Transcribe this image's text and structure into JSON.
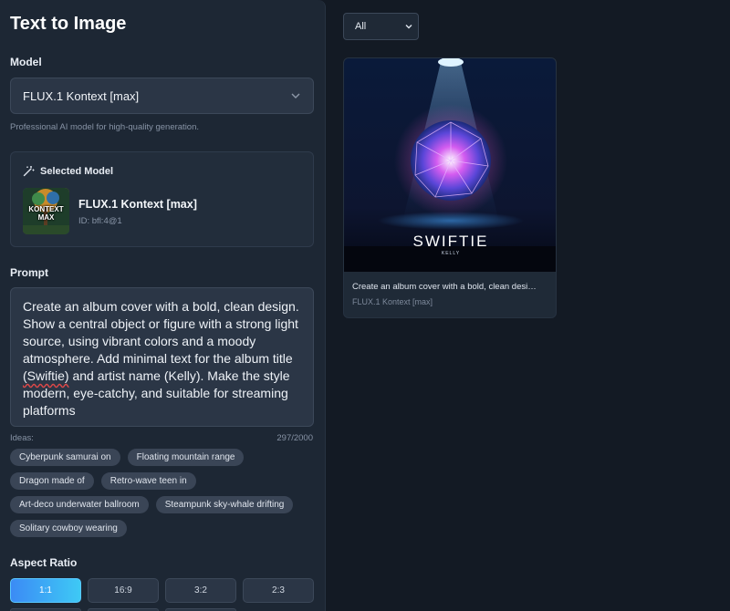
{
  "panel": {
    "title": "Text to Image",
    "model_label": "Model",
    "model_value": "FLUX.1 Kontext [max]",
    "model_helper": "Professional AI model for high-quality generation.",
    "selected": {
      "heading": "Selected Model",
      "name": "FLUX.1 Kontext [max]",
      "id": "ID: bfl:4@1",
      "thumb_text_top": "KONTEXT",
      "thumb_text_bottom": "MAX"
    },
    "prompt_label": "Prompt",
    "prompt": {
      "before": "Create an album cover with a bold, clean design. Show a central object or figure with a strong light source, using vibrant colors and a moody atmosphere. Add minimal text for the album title ",
      "underlined": "(Swiftie)",
      "after": " and artist name (Kelly). Make the style modern, eye-catchy, and suitable for streaming platforms"
    },
    "ideas_label": "Ideas:",
    "char_count": "297/2000",
    "ideas": [
      "Cyberpunk samurai on",
      "Floating mountain range",
      "Dragon made of",
      "Retro-wave teen in",
      "Art-deco underwater ballroom",
      "Steampunk sky-whale drifting",
      "Solitary cowboy wearing"
    ],
    "aspect_label": "Aspect Ratio",
    "ratios": [
      "1:1",
      "16:9",
      "3:2",
      "2:3"
    ]
  },
  "gallery": {
    "filter": "All",
    "items": [
      {
        "caption": "Create an album cover with a bold, clean design. Show a central object or figure with a strong light source",
        "model": "FLUX.1 Kontext [max]",
        "art_title": "SWIFTIE",
        "art_artist": "KELLY"
      }
    ]
  },
  "colors": {
    "accent_start": "#3b8bf5",
    "accent_end": "#3ec9f5",
    "panel_bg": "#1d2734",
    "page_bg": "#131a24"
  }
}
